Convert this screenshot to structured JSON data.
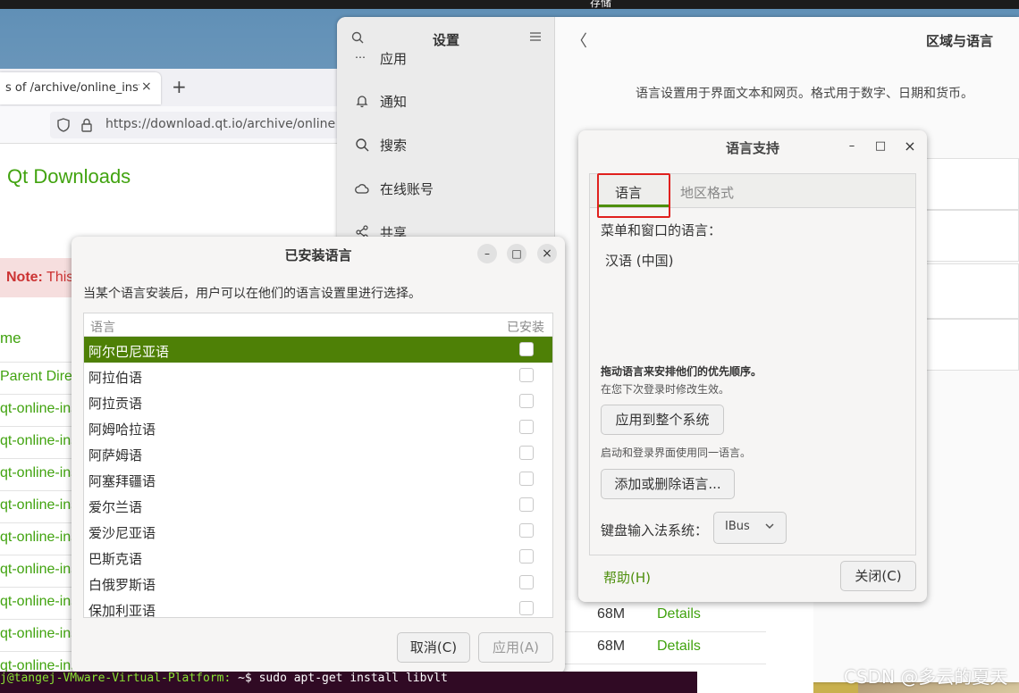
{
  "top_bar": {
    "title": "存储"
  },
  "terminal": {
    "prompt": "j@tangej-VMware-Virtual-Platform:",
    "command": " ~$ sudo apt-get install libvlt"
  },
  "browser": {
    "tab_label": "s of /archive/online_inst",
    "tab_close": "×",
    "new_tab": "+",
    "url": "https://download.qt.io/archive/online",
    "page_title": "Qt Downloads",
    "note_bold": "Note:",
    "note_text": " This",
    "column_name": "me",
    "files": [
      "Parent Direc",
      "qt-online-ins",
      "qt-online-ins",
      "qt-online-ins",
      "qt-online-ins",
      "qt-online-ins",
      "qt-online-ins",
      "qt-online-ins",
      "qt-online-ins",
      "qt-online-ins"
    ],
    "right_rows": [
      {
        "size": "68M",
        "details": "Details"
      },
      {
        "size": "68M",
        "details": "Details"
      }
    ],
    "hidden_row": {
      "size": "68M",
      "details": "Details"
    }
  },
  "settings": {
    "title": "设置",
    "sidebar_items": [
      "应用",
      "通知",
      "搜索",
      "在线账号",
      "共享"
    ],
    "main_title": "区域与语言",
    "main_desc": "语言设置用于界面文本和网页。格式用于数字、日期和货币。",
    "back": "〈"
  },
  "language_support": {
    "title": "语言支持",
    "min": "–",
    "max": "□",
    "close": "×",
    "tab_language": "语言",
    "tab_region": "地区格式",
    "menu_lang_label": "菜单和窗口的语言：",
    "current_lang": "汉语 (中国)",
    "drag_hint": "拖动语言来安排他们的优先顺序。",
    "effect_hint": "在您下次登录时修改生效。",
    "apply_system": "应用到整个系统",
    "login_hint": "启动和登录界面使用同一语言。",
    "add_remove": "添加或删除语言...",
    "ime_label": "键盘输入法系统：",
    "ime_value": "IBus",
    "help": "帮助(H)",
    "close_button": "关闭(C)",
    "accent_color": "#4e8f0d",
    "highlight_color": "#e0201d"
  },
  "installed_languages": {
    "title": "已安装语言",
    "min": "–",
    "max": "□",
    "close": "×",
    "description": "当某个语言安装后，用户可以在他们的语言设置里进行选择。",
    "col_language": "语言",
    "col_installed": "已安装",
    "rows": [
      "阿尔巴尼亚语",
      "阿拉伯语",
      "阿拉贡语",
      "阿姆哈拉语",
      "阿萨姆语",
      "阿塞拜疆语",
      "爱尔兰语",
      "爱沙尼亚语",
      "巴斯克语",
      "白俄罗斯语",
      "保加利亚语"
    ],
    "selected_index": 0,
    "cancel": "取消(C)",
    "apply": "应用(A)",
    "selection_color": "#4e8006"
  },
  "watermark": "CSDN @多云的夏天"
}
